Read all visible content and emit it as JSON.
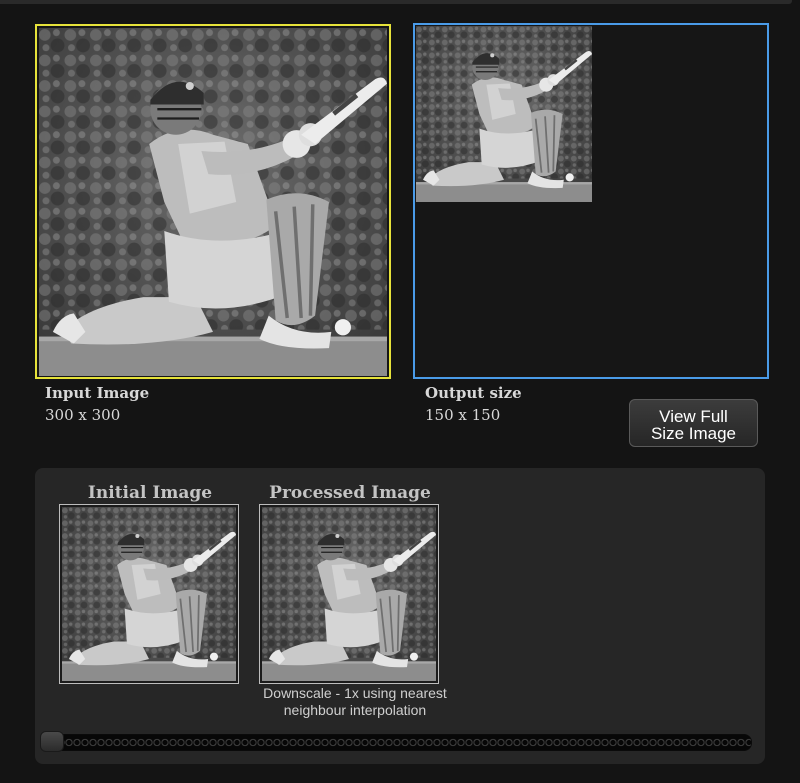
{
  "input": {
    "title": "Input Image",
    "size": "300 x 300"
  },
  "output": {
    "title": "Output size",
    "size": "150 x 150"
  },
  "view_full_button": {
    "line1": "View Full",
    "line2": "Size Image"
  },
  "thumbnails": {
    "initial_title": "Initial Image",
    "processed_title": "Processed Image",
    "processed_description": "Downscale - 1x using nearest neighbour interpolation"
  },
  "slider": {
    "value": 0
  },
  "colors": {
    "input_border": "#e6e23a",
    "output_border": "#4a9be8",
    "background": "#141414",
    "panel": "#262626"
  }
}
